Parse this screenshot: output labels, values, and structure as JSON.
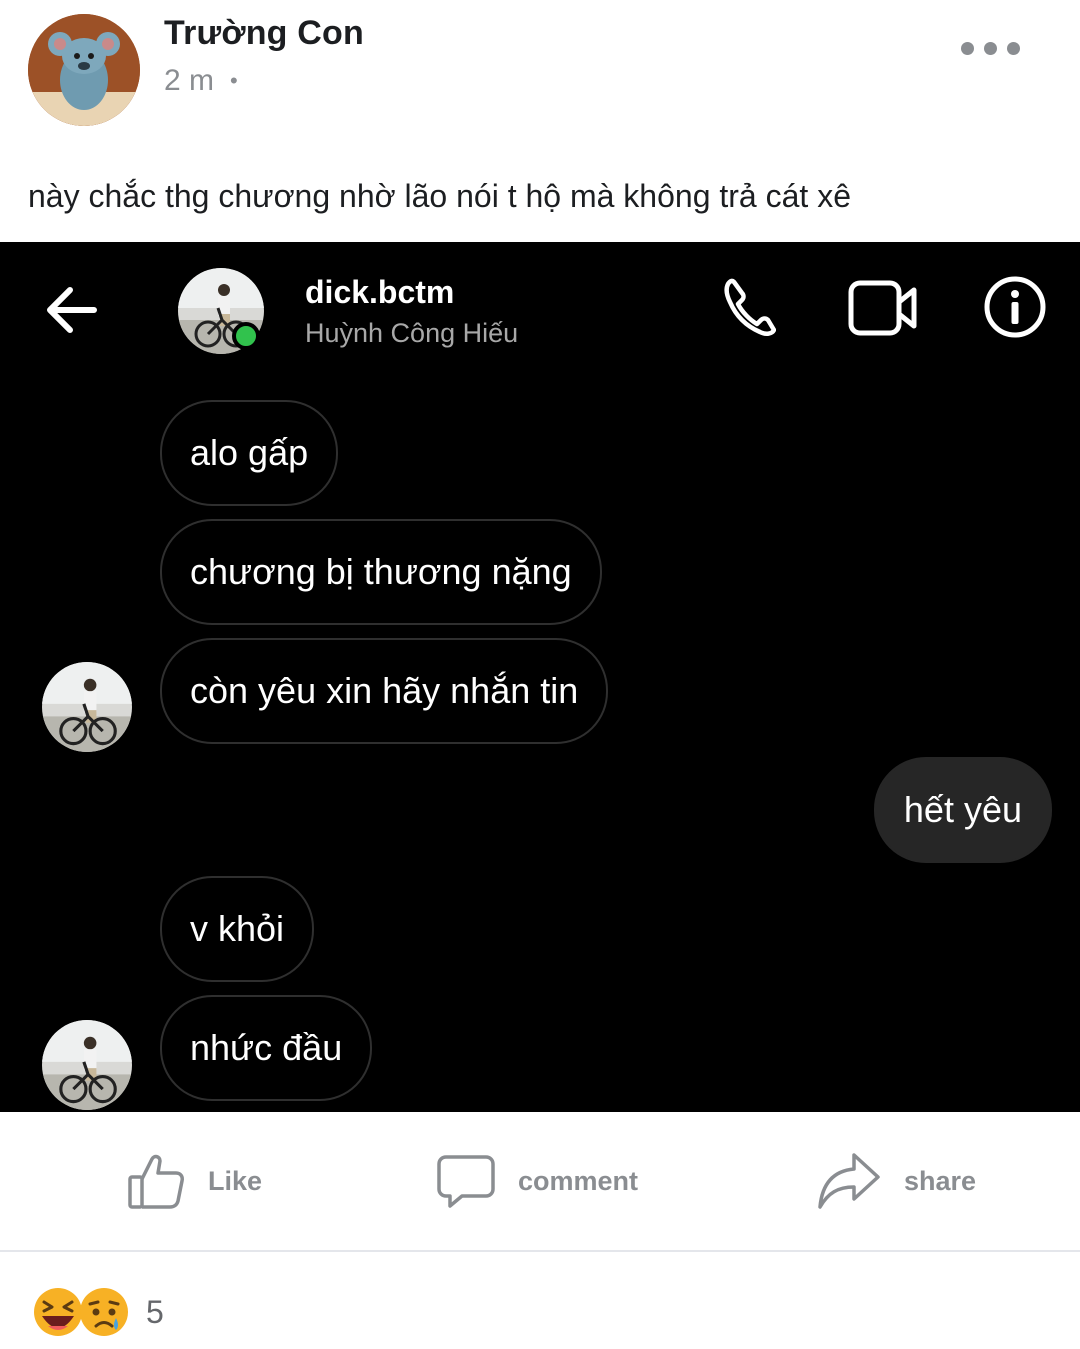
{
  "post": {
    "author_name": "Trường Con",
    "timestamp": "2 m",
    "meta_separator": "•",
    "caption": "này chắc thg chương nhờ lão nói t hộ mà không trả cát xê"
  },
  "chat": {
    "username": "dick.bctm",
    "full_name": "Huỳnh Công Hiếu",
    "online": true,
    "messages": [
      {
        "from": "them",
        "text": "alo gấp"
      },
      {
        "from": "them",
        "text": "chương bị thương nặng"
      },
      {
        "from": "them",
        "text": "còn yêu xin hãy nhắn tin"
      },
      {
        "from": "me",
        "text": "hết yêu"
      },
      {
        "from": "them",
        "text": "v khỏi"
      },
      {
        "from": "them",
        "text": "nhức đầu"
      }
    ],
    "icons": [
      "back-arrow-icon",
      "phone-icon",
      "video-camera-icon",
      "info-icon"
    ]
  },
  "actions": {
    "like_label": "Like",
    "comment_label": "comment",
    "share_label": "share"
  },
  "reactions": {
    "emojis": [
      "laughing-emoji",
      "sad-emoji"
    ],
    "count": "5"
  },
  "colors": {
    "online": "#31c24d",
    "chat_background": "#000000",
    "outgoing_bubble": "#262626",
    "muted_text": "#8a8d91"
  }
}
